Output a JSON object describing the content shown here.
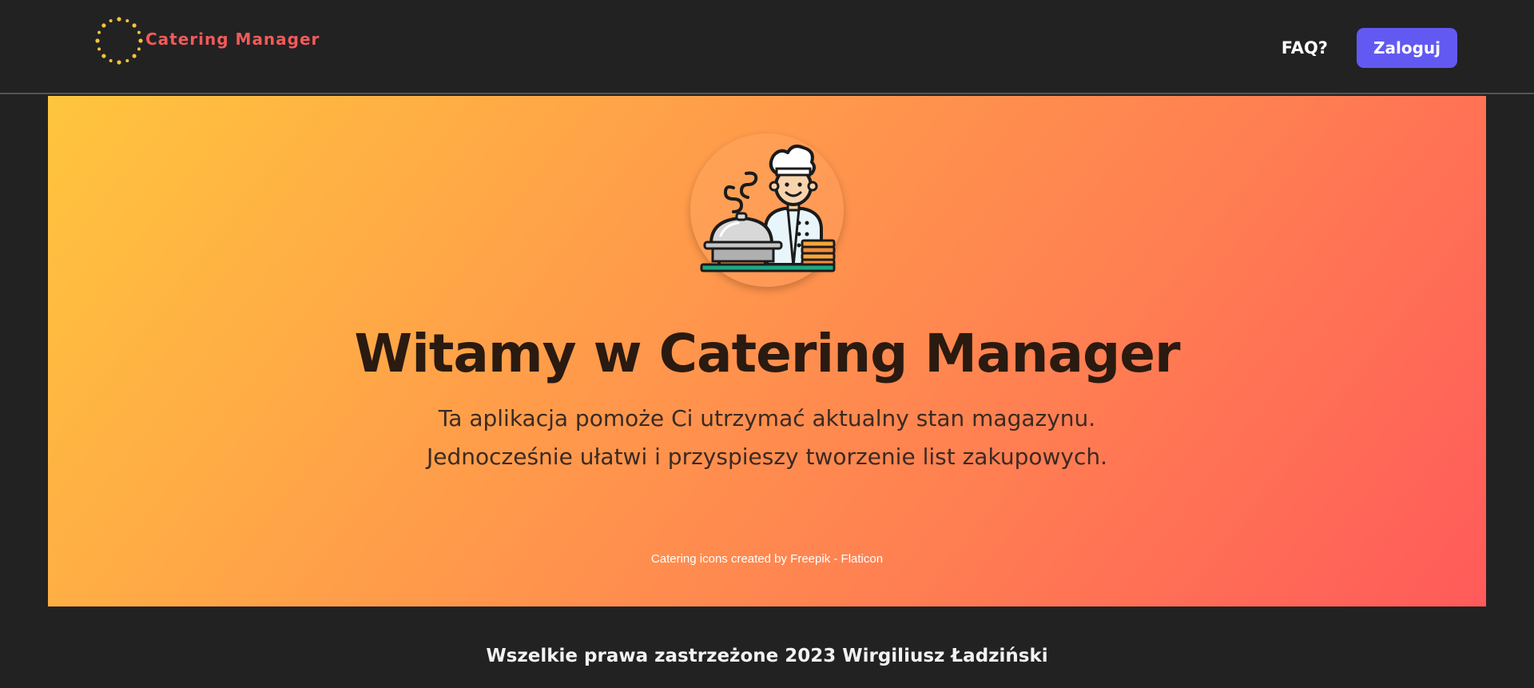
{
  "navbar": {
    "brand_name": "Catering Manager",
    "brand_icon": "dotted-circle-logo-icon",
    "faq_label": "FAQ?",
    "login_label": "Zaloguj"
  },
  "hero": {
    "icon": "chef-with-cloche-icon",
    "title": "Witamy w Catering Manager",
    "description": "Ta aplikacja pomoże Ci utrzymać aktualny stan magazynu. Jednocześnie ułatwi i przyspieszy tworzenie list zakupowych.",
    "credit_link": "Catering icons created by Freepik - Flaticon"
  },
  "footer": {
    "text": "Wszelkie prawa zastrzeżone 2023 Wirgiliusz Ładziński"
  },
  "colors": {
    "background": "#222222",
    "brand": "#f15a5a",
    "logo_dots": "#f6c33a",
    "button": "#6259f2",
    "gradient_start": "#ffc53d",
    "gradient_end": "#ff5a5a"
  }
}
